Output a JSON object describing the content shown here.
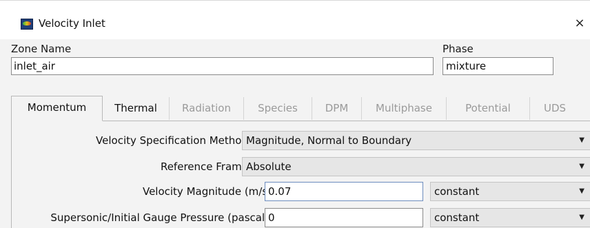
{
  "window": {
    "title": "Velocity Inlet",
    "close_glyph": "×",
    "app_icon": "fluent-app-icon"
  },
  "zone": {
    "label": "Zone Name",
    "value": "inlet_air"
  },
  "phase": {
    "label": "Phase",
    "value": "mixture"
  },
  "tabs": [
    {
      "label": "Momentum",
      "active": true,
      "enabled": true
    },
    {
      "label": "Thermal",
      "active": false,
      "enabled": true
    },
    {
      "label": "Radiation",
      "active": false,
      "enabled": false
    },
    {
      "label": "Species",
      "active": false,
      "enabled": false
    },
    {
      "label": "DPM",
      "active": false,
      "enabled": false
    },
    {
      "label": "Multiphase",
      "active": false,
      "enabled": false
    },
    {
      "label": "Potential",
      "active": false,
      "enabled": false
    },
    {
      "label": "UDS",
      "active": false,
      "enabled": false
    }
  ],
  "momentum": {
    "velocity_spec": {
      "label": "Velocity Specification Method",
      "value": "Magnitude, Normal to Boundary"
    },
    "reference_frame": {
      "label": "Reference Frame",
      "value": "Absolute"
    },
    "velocity_magnitude": {
      "label": "Velocity Magnitude (m/s)",
      "value": "0.07",
      "method": "constant"
    },
    "gauge_pressure": {
      "label": "Supersonic/Initial Gauge Pressure (pascal)",
      "value": "0",
      "method": "constant"
    }
  },
  "icons": {
    "dropdown": "▼"
  }
}
